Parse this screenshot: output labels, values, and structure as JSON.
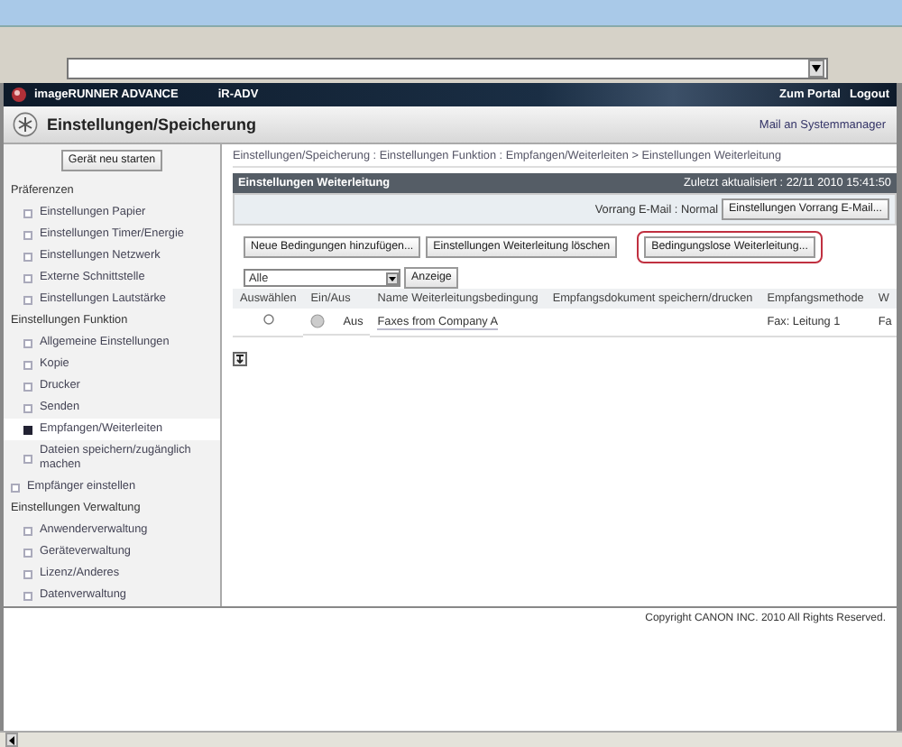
{
  "header": {
    "brand": "imageRUNNER ADVANCE",
    "device": "iR-ADV",
    "links": [
      "Zum Portal",
      "Logout"
    ]
  },
  "title_bar": {
    "title": "Einstellungen/Speicherung",
    "mail_link": "Mail an Systemmanager"
  },
  "sidebar": {
    "restart_button": "Gerät neu starten",
    "items": [
      {
        "label": "Präferenzen",
        "kind": "group",
        "children": [
          {
            "label": "Einstellungen Papier",
            "selected": false
          },
          {
            "label": "Einstellungen Timer/Energie",
            "selected": false
          },
          {
            "label": "Einstellungen Netzwerk",
            "selected": false
          },
          {
            "label": "Externe Schnittstelle",
            "selected": false
          },
          {
            "label": "Einstellungen Lautstärke",
            "selected": false
          }
        ]
      },
      {
        "label": "Einstellungen Funktion",
        "kind": "group",
        "children": [
          {
            "label": "Allgemeine Einstellungen",
            "selected": false
          },
          {
            "label": "Kopie",
            "selected": false
          },
          {
            "label": "Drucker",
            "selected": false
          },
          {
            "label": "Senden",
            "selected": false
          },
          {
            "label": "Empfangen/Weiterleiten",
            "selected": true
          },
          {
            "label": "Dateien speichern/zugänglich machen",
            "selected": false
          }
        ]
      },
      {
        "label": "Empfänger einstellen",
        "kind": "link",
        "selected": false
      },
      {
        "label": "Einstellungen Verwaltung",
        "kind": "group",
        "children": [
          {
            "label": "Anwenderverwaltung",
            "selected": false
          },
          {
            "label": "Geräteverwaltung",
            "selected": false
          },
          {
            "label": "Lizenz/Anderes",
            "selected": false
          },
          {
            "label": "Datenverwaltung",
            "selected": false
          }
        ]
      }
    ]
  },
  "breadcrumb": "Einstellungen/Speicherung : Einstellungen Funktion : Empfangen/Weiterleiten > Einstellungen Weiterleitung",
  "panel": {
    "title": "Einstellungen Weiterleitung",
    "updated": "Zuletzt aktualisiert : 22/11 2010 15:41:50",
    "priority": "Vorrang E-Mail : Normal",
    "priority_button": "Einstellungen Vorrang E-Mail..."
  },
  "actions": [
    {
      "label": "Neue Bedingungen hinzufügen...",
      "highlighted": false
    },
    {
      "label": "Einstellungen Weiterleitung löschen",
      "highlighted": false
    },
    {
      "label": "Bedingungslose Weiterleitung...",
      "highlighted": true
    }
  ],
  "filter": {
    "value": "Alle",
    "button": "Anzeige"
  },
  "table": {
    "columns": [
      "Auswählen",
      "Ein/Aus",
      "Name Weiterleitungsbedingung",
      "Empfangsdokument speichern/drucken",
      "Empfangsmethode",
      "W"
    ],
    "rows": [
      {
        "selected": false,
        "on": false,
        "state_label": "Aus",
        "name": "Faxes from Company A",
        "method": "Fax: Leitung 1",
        "column_6": "Fa"
      }
    ]
  },
  "footer": "Copyright CANON INC. 2010 All Rights Reserved."
}
